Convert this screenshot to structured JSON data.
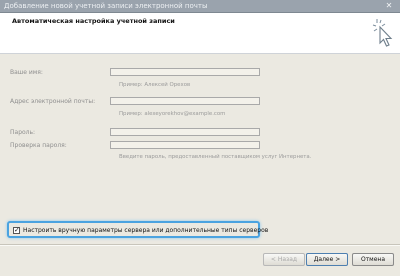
{
  "window": {
    "title": "Добавление новой учетной записи электронной почты",
    "close_glyph": "✕"
  },
  "header": {
    "title": "Автоматическая настройка учетной записи"
  },
  "form": {
    "name_label": "Ваше имя:",
    "name_value": "",
    "name_hint": "Пример: Алексей Орехов",
    "email_label": "Адрес электронной почты:",
    "email_value": "",
    "email_hint": "Пример: alexeyorekhov@example.com",
    "password_label": "Пароль:",
    "password_value": "",
    "confirm_label": "Проверка пароля:",
    "confirm_value": "",
    "password_hint": "Введите пароль, предоставленный поставщиком услуг Интернета."
  },
  "manual_setup": {
    "label": "Настроить вручную параметры сервера или дополнительные типы серверов",
    "checked": true,
    "check_glyph": "✓"
  },
  "buttons": {
    "back": "< Назад",
    "next": "Далее >",
    "cancel": "Отмена"
  },
  "colors": {
    "titlebar": "#9aa3ad",
    "dialog_bg": "#ebe9e1",
    "highlight": "#4ba3e0"
  }
}
